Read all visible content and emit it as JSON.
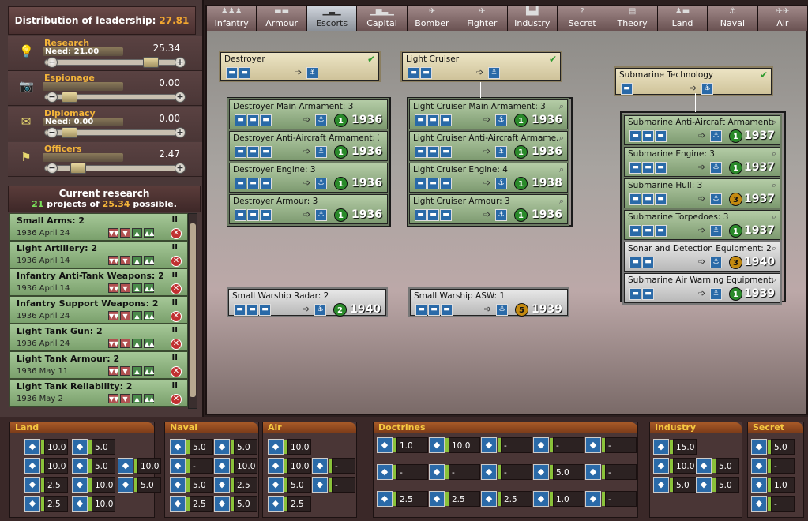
{
  "leadership": {
    "title": "Distribution of leadership:",
    "total": "27.81"
  },
  "categories": [
    {
      "label": "Research",
      "need": "Need: 21.00",
      "value": "25.34",
      "icon": "lightbulb-icon",
      "glyph": "💡",
      "thumb": 0.78
    },
    {
      "label": "Espionage",
      "need": "",
      "value": "0.00",
      "icon": "camera-icon",
      "glyph": "📷",
      "thumb": 0.04
    },
    {
      "label": "Diplomacy",
      "need": "Need: 0.00",
      "value": "0.00",
      "icon": "envelope-icon",
      "glyph": "✉",
      "thumb": 0.04
    },
    {
      "label": "Officers",
      "need": "",
      "value": "2.47",
      "icon": "flag-icon",
      "glyph": "⚑",
      "thumb": 0.12
    }
  ],
  "current_research": {
    "title": "Current research",
    "count": "21",
    "mid": "projects of",
    "possible": "25.34",
    "end": "possible."
  },
  "research_items": [
    {
      "name": "Small Arms: 2",
      "date": "1936 April 24"
    },
    {
      "name": "Light Artillery: 2",
      "date": "1936 April 14"
    },
    {
      "name": "Infantry Anti-Tank Weapons: 2",
      "date": "1936 April 14"
    },
    {
      "name": "Infantry Support Weapons: 2",
      "date": "1936 April 24"
    },
    {
      "name": "Light Tank Gun: 2",
      "date": "1936 April 24"
    },
    {
      "name": "Light Tank Armour: 2",
      "date": "1936 May 11"
    },
    {
      "name": "Light Tank Reliability: 2",
      "date": "1936 May 2"
    }
  ],
  "pause_symbol": "II",
  "tabs": [
    {
      "label": "Infantry",
      "icon": "infantry-icon",
      "glyph": "♟♟♟"
    },
    {
      "label": "Armour",
      "icon": "tank-icon",
      "glyph": "▬▬"
    },
    {
      "label": "Escorts",
      "icon": "destroyer-icon",
      "glyph": "▁▃▁"
    },
    {
      "label": "Capital",
      "icon": "battleship-icon",
      "glyph": "▁▅▃▁"
    },
    {
      "label": "Bomber",
      "icon": "bomber-icon",
      "glyph": "✈"
    },
    {
      "label": "Fighter",
      "icon": "fighter-icon",
      "glyph": "✈"
    },
    {
      "label": "Industry",
      "icon": "factory-icon",
      "glyph": "▙▟"
    },
    {
      "label": "Secret",
      "icon": "question-icon",
      "glyph": "?"
    },
    {
      "label": "Theory",
      "icon": "book-icon",
      "glyph": "▤"
    },
    {
      "label": "Land",
      "icon": "land-icon",
      "glyph": "♟▬"
    },
    {
      "label": "Naval",
      "icon": "naval-icon",
      "glyph": "⚓"
    },
    {
      "label": "Air",
      "icon": "air-icon",
      "glyph": "✈✈"
    }
  ],
  "active_tab": 2,
  "tech_roots": [
    {
      "name": "Destroyer"
    },
    {
      "name": "Light Cruiser"
    },
    {
      "name": "Submarine Technology"
    }
  ],
  "tech_nodes": [
    {
      "name": "Destroyer Main Armament: 3",
      "level": "1",
      "year": "1936",
      "style": "grn"
    },
    {
      "name": "Destroyer Anti-Aircraft Armament: 3",
      "level": "1",
      "year": "1936",
      "style": "grn"
    },
    {
      "name": "Destroyer Engine: 3",
      "level": "1",
      "year": "1936",
      "style": "grn"
    },
    {
      "name": "Destroyer Armour: 3",
      "level": "1",
      "year": "1936",
      "style": "grn"
    },
    {
      "name": "Light Cruiser Main Armament: 3",
      "level": "1",
      "year": "1936",
      "style": "grn"
    },
    {
      "name": "Light Cruiser Anti-Aircraft Armame...",
      "level": "1",
      "year": "1936",
      "style": "grn"
    },
    {
      "name": "Light Cruiser Engine: 4",
      "level": "1",
      "year": "1938",
      "style": "grn"
    },
    {
      "name": "Light Cruiser Armour: 3",
      "level": "1",
      "year": "1936",
      "style": "grn"
    },
    {
      "name": "Submarine Anti-Aircraft Armament: 3",
      "level": "1",
      "year": "1937",
      "style": "grn"
    },
    {
      "name": "Submarine Engine: 3",
      "level": "1",
      "year": "1937",
      "style": "grn"
    },
    {
      "name": "Submarine Hull: 3",
      "level": "3",
      "year": "1937",
      "style": "grn"
    },
    {
      "name": "Submarine Torpedoes: 3",
      "level": "1",
      "year": "1937",
      "style": "grn"
    },
    {
      "name": "Sonar and Detection Equipment: 2",
      "level": "3",
      "year": "1940",
      "style": "gry"
    },
    {
      "name": "Submarine Air Warning Equipment: 1",
      "level": "1",
      "year": "1939",
      "style": "gry"
    },
    {
      "name": "Small Warship Radar: 2",
      "level": "2",
      "year": "1940",
      "style": "gry"
    },
    {
      "name": "Small Warship ASW: 1",
      "level": "5",
      "year": "1939",
      "style": "gry"
    }
  ],
  "bottom": {
    "land": {
      "title": "Land",
      "values": [
        "10.0",
        "10.0",
        "2.5",
        "2.5",
        "5.0",
        "5.0",
        "10.0",
        "10.0",
        "10.0",
        "5.0"
      ]
    },
    "naval": {
      "title": "Naval",
      "values": [
        "5.0",
        "-",
        "5.0",
        "2.5",
        "5.0",
        "10.0",
        "2.5",
        "5.0"
      ]
    },
    "air": {
      "title": "Air",
      "values": [
        "10.0",
        "10.0",
        "5.0",
        "2.5",
        "-",
        "-"
      ]
    },
    "doctrines": {
      "title": "Doctrines",
      "values": [
        "1.0",
        "10.0",
        "-",
        "-",
        "-",
        "-",
        "-",
        "-",
        "5.0",
        "-",
        "2.5",
        "2.5",
        "2.5",
        "1.0",
        "-"
      ]
    },
    "industry": {
      "title": "Industry",
      "values": [
        "15.0",
        "10.0",
        "5.0",
        "5.0",
        "5.0"
      ]
    },
    "secret": {
      "title": "Secret",
      "values": [
        "5.0",
        "-",
        "1.0",
        "-"
      ]
    }
  }
}
